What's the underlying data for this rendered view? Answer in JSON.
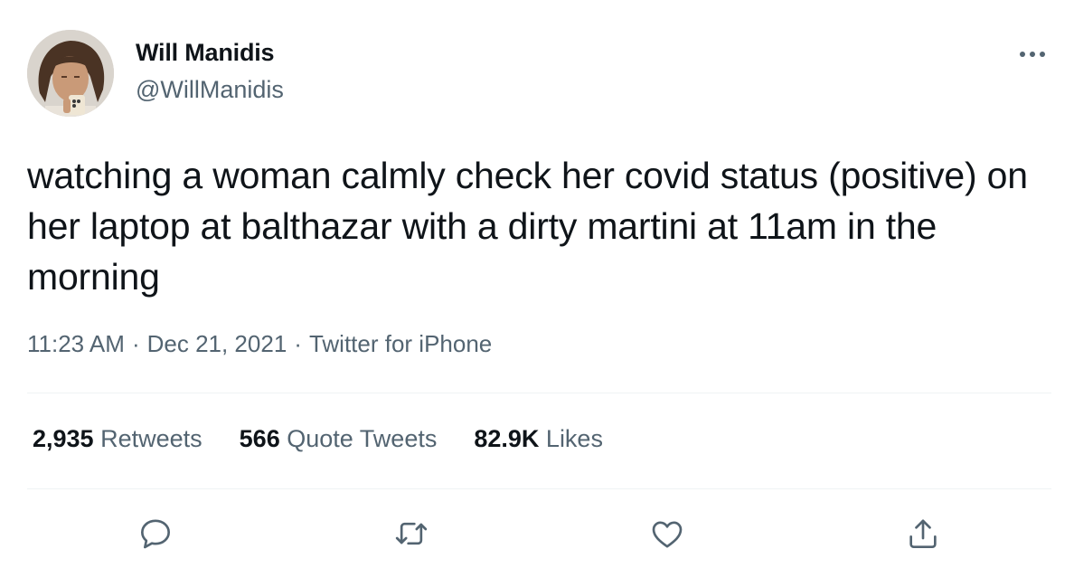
{
  "user": {
    "name": "Will Manidis",
    "handle": "@WillManidis"
  },
  "tweet": {
    "text": "watching a woman calmly check her covid status (positive) on her laptop at balthazar with a dirty martini at 11am in the morning",
    "time": "11:23 AM",
    "date": "Dec 21, 2021",
    "source": "Twitter for iPhone",
    "separator": "·"
  },
  "stats": {
    "retweets_count": "2,935",
    "retweets_label": "Retweets",
    "quotes_count": "566",
    "quotes_label": "Quote Tweets",
    "likes_count": "82.9K",
    "likes_label": "Likes"
  },
  "icons": {
    "more": "more-horizontal-icon",
    "reply": "reply-icon",
    "retweet": "retweet-icon",
    "like": "heart-icon",
    "share": "share-icon"
  },
  "colors": {
    "text_primary": "#0f1419",
    "text_secondary": "#536471",
    "divider": "#eff3f4"
  }
}
